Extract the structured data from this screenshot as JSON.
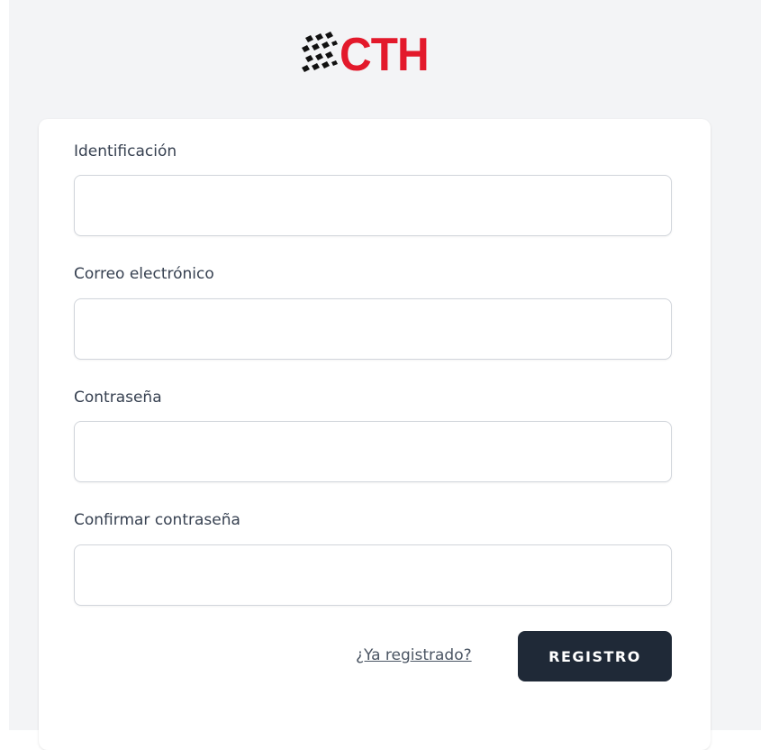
{
  "brand": {
    "logo_text": "CTH",
    "logo_text_color": "#e3192b",
    "logo_mark_icon": "checkered-flag-icon"
  },
  "form": {
    "fields": [
      {
        "label": "Identificación",
        "value": ""
      },
      {
        "label": "Correo electrónico",
        "value": ""
      },
      {
        "label": "Contraseña",
        "value": ""
      },
      {
        "label": "Confirmar contraseña",
        "value": ""
      }
    ],
    "login_link_text": "¿Ya registrado?",
    "submit_label": "REGISTRO"
  },
  "colors": {
    "page_background": "#f3f4f6",
    "card_background": "#ffffff",
    "button_background": "#1f2937",
    "button_text": "#ffffff",
    "label_text": "#374151"
  }
}
